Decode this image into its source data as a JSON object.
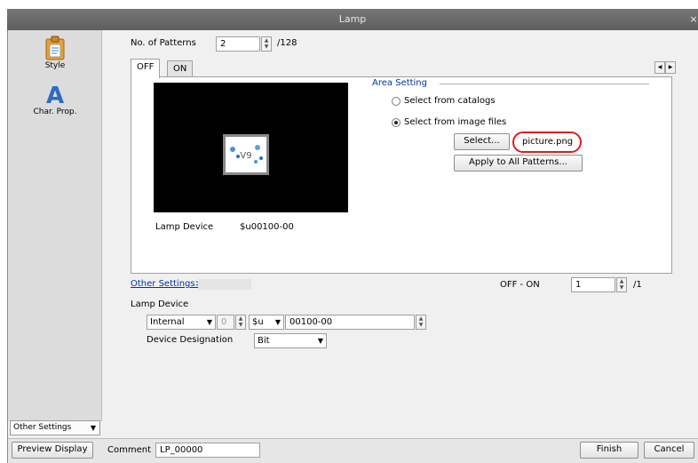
{
  "window": {
    "title": "Lamp",
    "close_glyph": "×"
  },
  "sidebar": {
    "items": [
      {
        "label": "Style",
        "icon": "clipboard-icon"
      },
      {
        "label": "Char. Prop.",
        "icon": "letter-a-icon"
      }
    ],
    "other_settings": "Other Settings"
  },
  "patterns": {
    "label": "No. of Patterns",
    "value": "2",
    "max": "/128"
  },
  "tabs": [
    "OFF",
    "ON"
  ],
  "preview": {
    "thumb_text": "V9",
    "device_label": "Lamp Device",
    "device_value": "$u00100-00"
  },
  "area": {
    "title": "Area Setting",
    "option_catalog": "Select from catalogs",
    "option_files": "Select from image files",
    "select_button": "Select...",
    "file_name": "picture.png",
    "apply_button": "Apply to All Patterns..."
  },
  "other_settings_link": "Other Settings>>",
  "off_on": {
    "label": "OFF - ON",
    "value": "1",
    "max": "/1"
  },
  "lamp_device": {
    "label": "Lamp Device",
    "type": "Internal",
    "num": "0",
    "prefix": "$u",
    "address": "00100-00",
    "designation_label": "Device Designation",
    "designation": "Bit"
  },
  "footer": {
    "preview": "Preview Display",
    "comment_label": "Comment",
    "comment": "LP_00000",
    "finish": "Finish",
    "cancel": "Cancel"
  }
}
